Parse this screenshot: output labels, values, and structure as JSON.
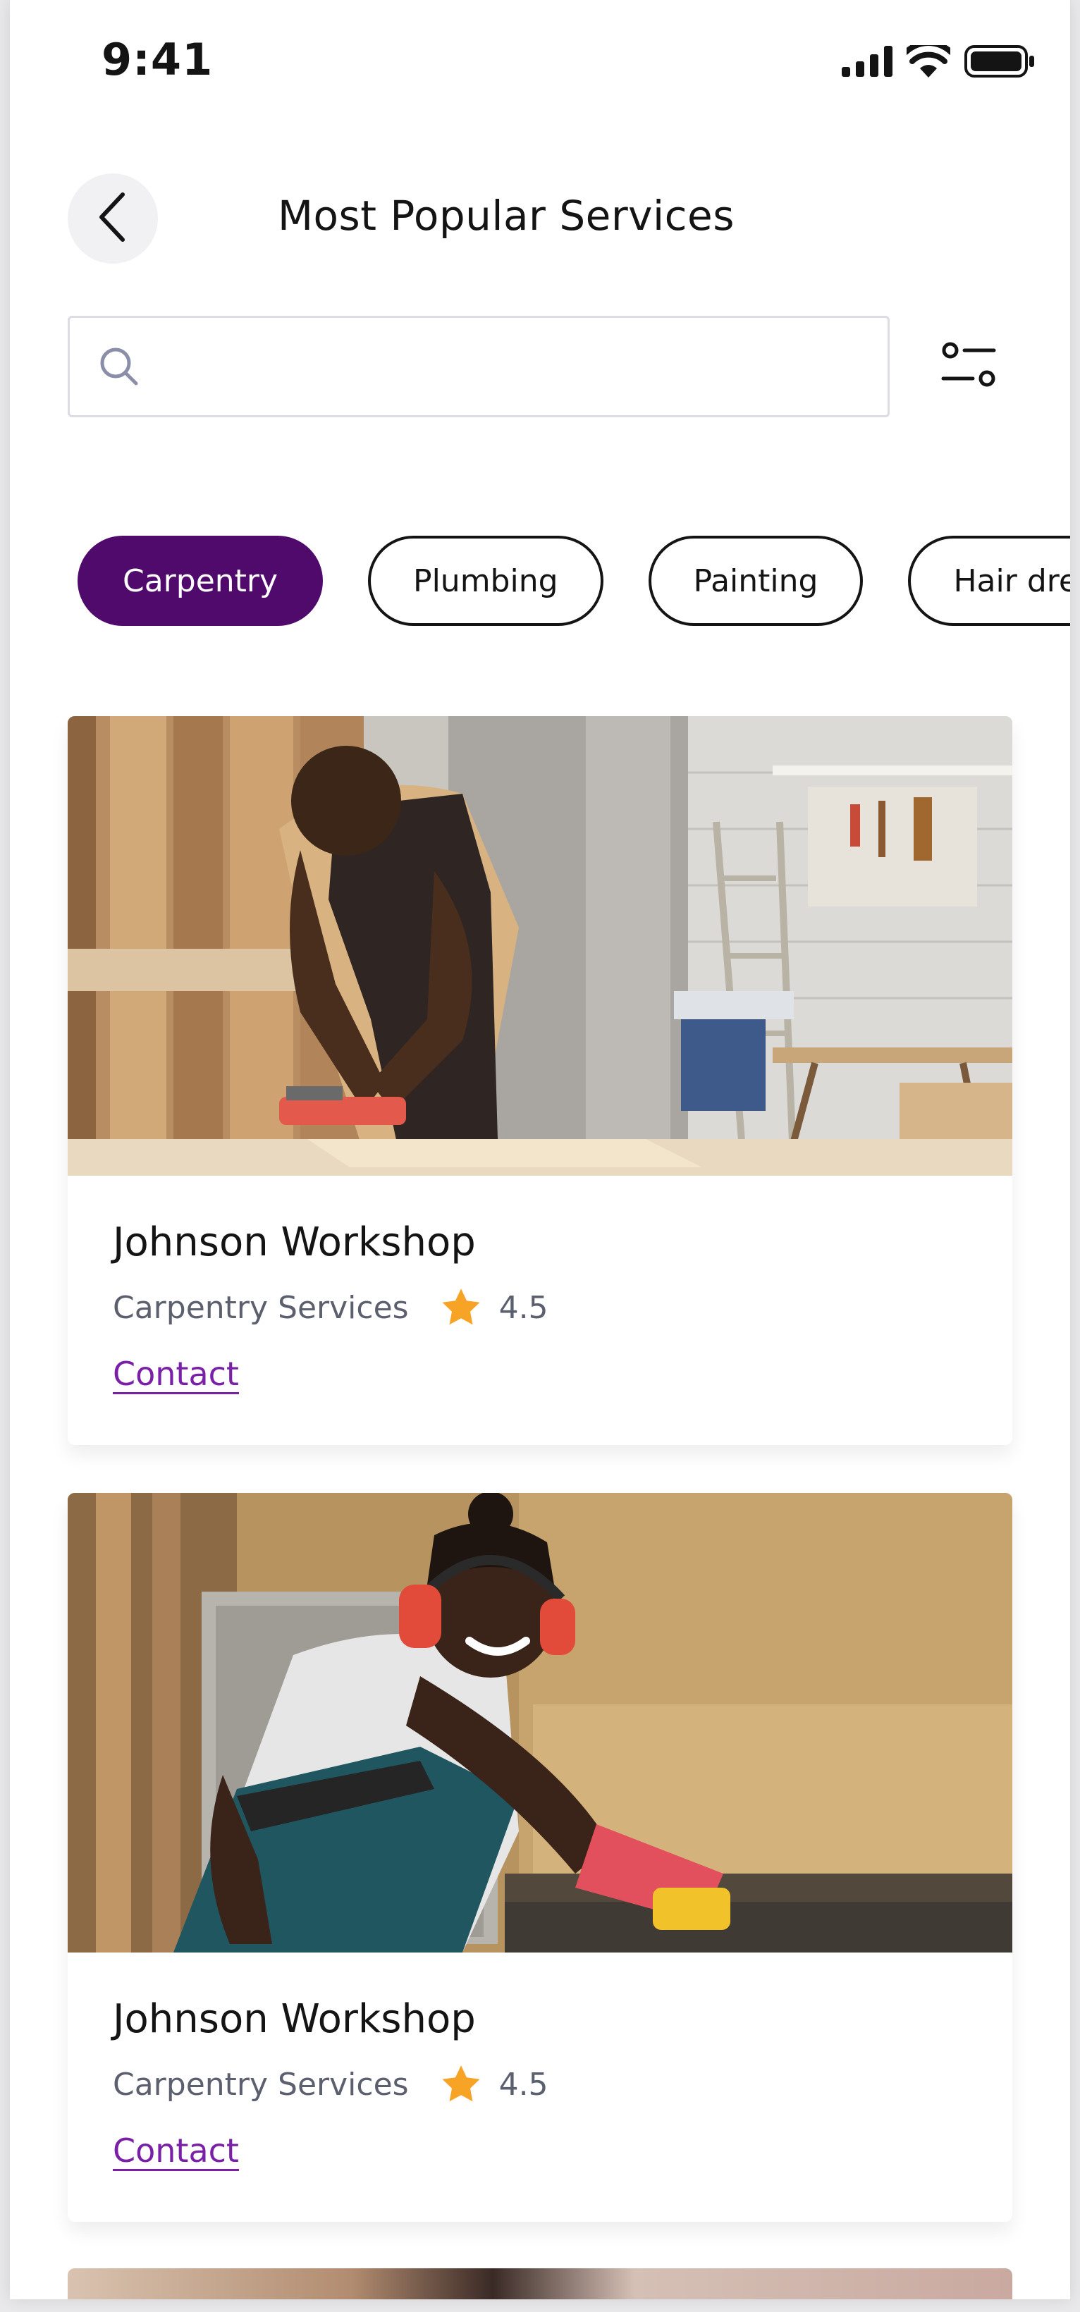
{
  "status_bar": {
    "time": "9:41",
    "icons": [
      "cellular-signal-icon",
      "wifi-icon",
      "battery-icon"
    ]
  },
  "header": {
    "back_icon": "chevron-left-icon",
    "title": "Most Popular Services"
  },
  "search": {
    "placeholder": "",
    "value": "",
    "icon": "search-icon",
    "filter_icon": "filter-sliders-icon"
  },
  "categories": {
    "items": [
      {
        "label": "Carpentry",
        "active": true
      },
      {
        "label": "Plumbing",
        "active": false
      },
      {
        "label": "Painting",
        "active": false
      },
      {
        "label": "Hair dresser",
        "active": false
      }
    ]
  },
  "services": [
    {
      "title": "Johnson Workshop",
      "category": "Carpentry Services",
      "rating": "4.5",
      "contact_label": "Contact",
      "photo": "carpenter-planing-wood-photo"
    },
    {
      "title": "Johnson Workshop",
      "category": "Carpentry Services",
      "rating": "4.5",
      "contact_label": "Contact",
      "photo": "woman-carpenter-with-earmuffs-photo"
    }
  ],
  "colors": {
    "accent": "#4f0a6b",
    "link": "#7a1fa8",
    "star": "#f7a325",
    "muted_text": "#5b5f6e"
  }
}
